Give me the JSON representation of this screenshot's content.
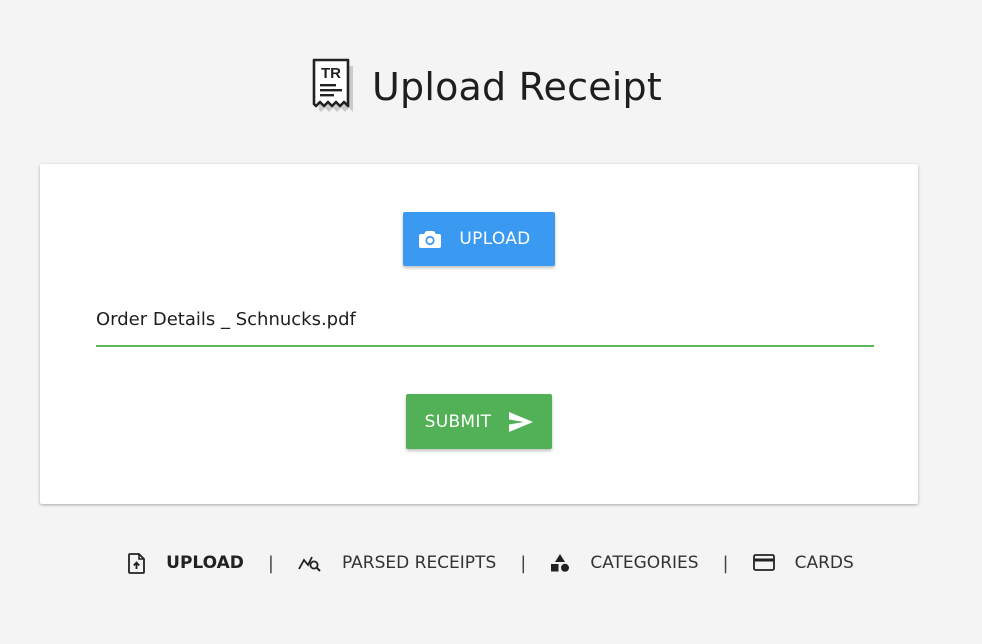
{
  "header": {
    "title": "Upload Receipt",
    "logo_icon": "receipt-icon",
    "logo_text": "TR"
  },
  "upload_card": {
    "upload_button": {
      "label": "UPLOAD",
      "icon": "camera-icon",
      "color": "#3a99f0"
    },
    "file_field": {
      "value": "Order Details _ Schnucks.pdf",
      "underline_color": "#5cb85c"
    },
    "submit_button": {
      "label": "SUBMIT",
      "icon": "send-icon",
      "color": "#52b057"
    }
  },
  "nav": {
    "items": [
      {
        "label": "UPLOAD",
        "icon": "file-upload-icon",
        "active": true
      },
      {
        "label": "PARSED RECEIPTS",
        "icon": "chart-search-icon",
        "active": false
      },
      {
        "label": "CATEGORIES",
        "icon": "shapes-icon",
        "active": false
      },
      {
        "label": "CARDS",
        "icon": "credit-card-icon",
        "active": false
      }
    ],
    "separator": "|"
  }
}
